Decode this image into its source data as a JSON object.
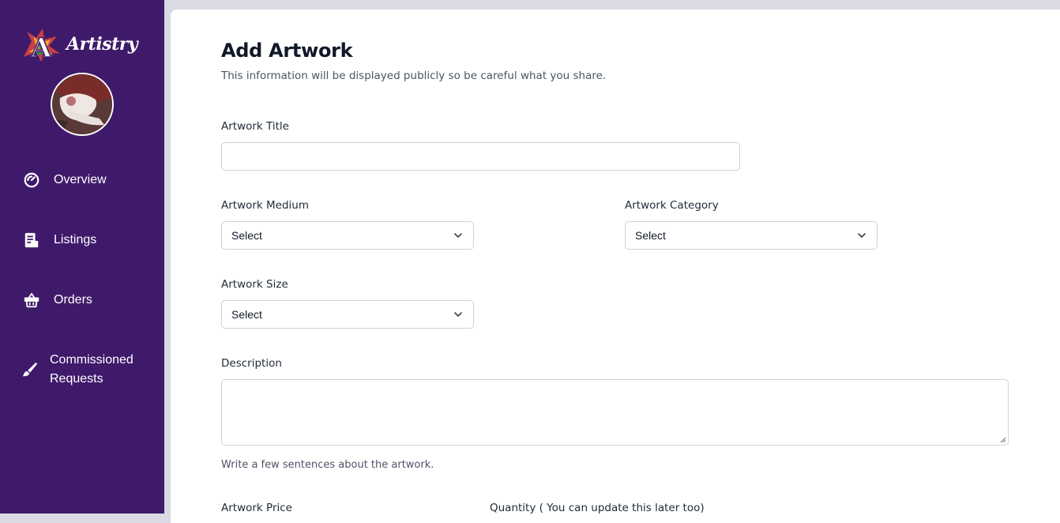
{
  "app": {
    "name": "Artistry"
  },
  "sidebar": {
    "items": [
      {
        "label": "Overview",
        "icon": "gauge-icon"
      },
      {
        "label": "Listings",
        "icon": "document-icon"
      },
      {
        "label": "Orders",
        "icon": "basket-icon"
      },
      {
        "label_line1": "Commissioned",
        "label_line2": "Requests",
        "icon": "brush-icon"
      }
    ],
    "colors": {
      "background": "#3f1a6b",
      "text": "#ffffff"
    }
  },
  "form": {
    "title": "Add Artwork",
    "subtitle": "This information will be displayed publicly so be careful what you share.",
    "artwork_title": {
      "label": "Artwork Title",
      "value": ""
    },
    "artwork_medium": {
      "label": "Artwork Medium",
      "value": "Select"
    },
    "artwork_category": {
      "label": "Artwork Category",
      "value": "Select"
    },
    "artwork_size": {
      "label": "Artwork Size",
      "value": "Select"
    },
    "description": {
      "label": "Description",
      "value": "",
      "help": "Write a few sentences about the artwork."
    },
    "artwork_price": {
      "label": "Artwork Price"
    },
    "quantity": {
      "label": "Quantity ( You can update this later too)"
    }
  }
}
